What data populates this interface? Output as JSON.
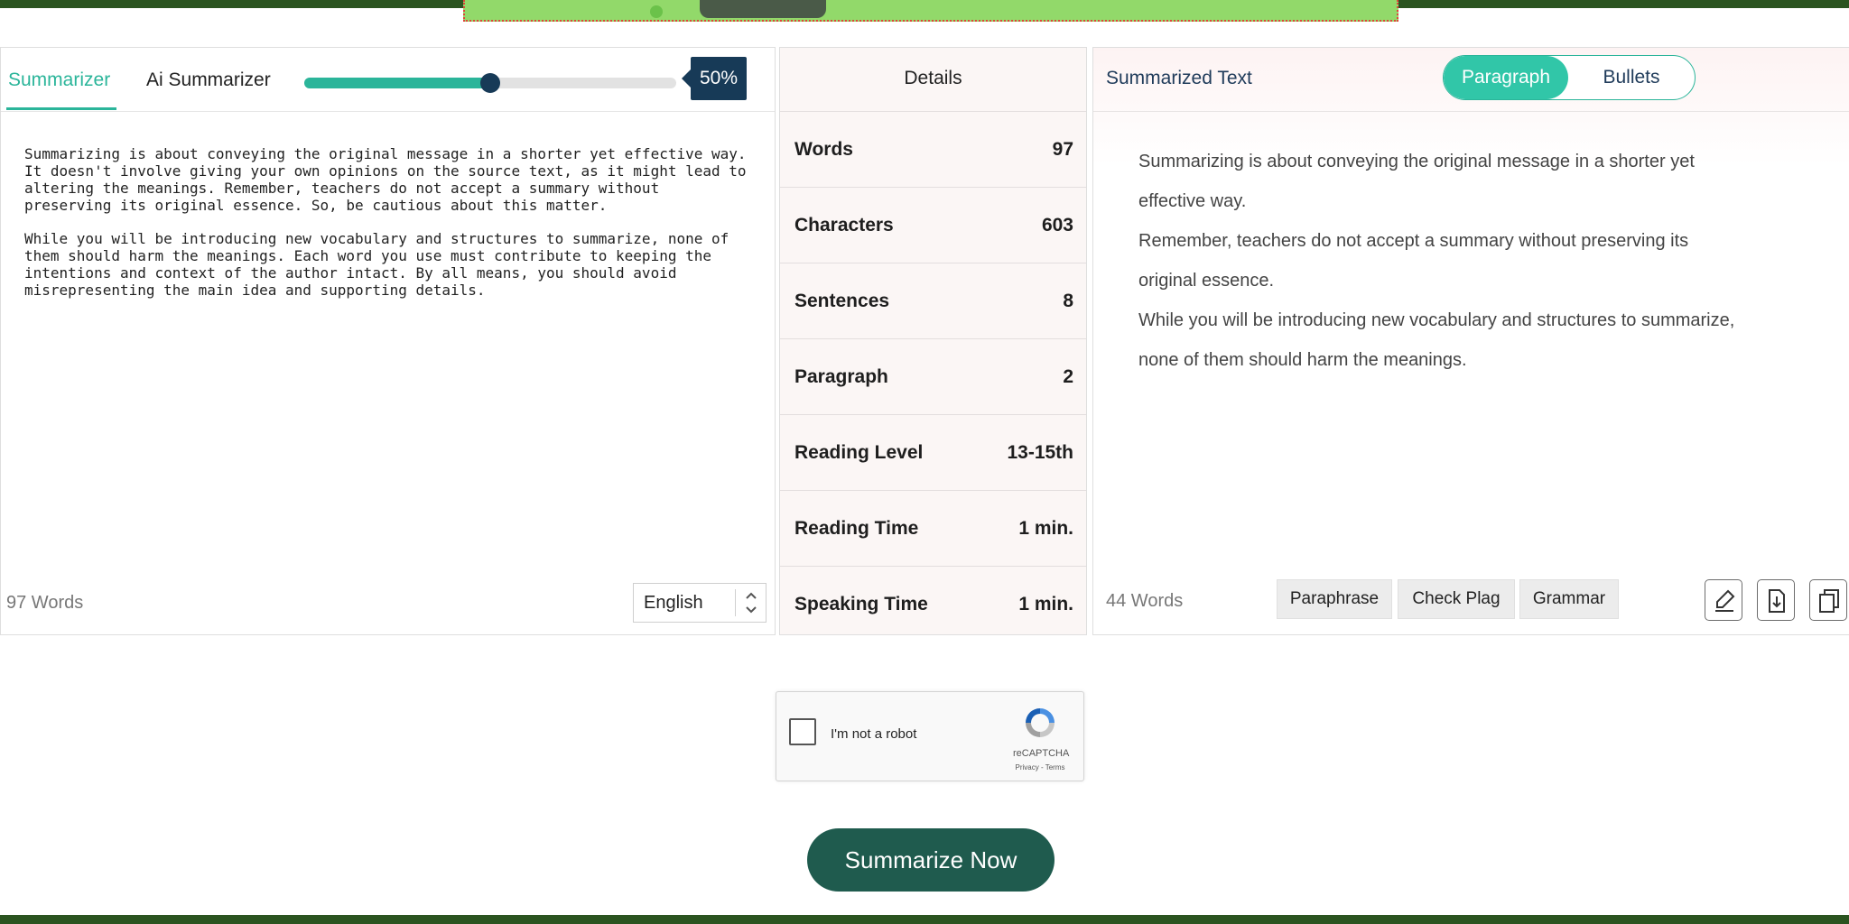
{
  "left": {
    "tab_active": "Summarizer",
    "tab_other": "Ai Summarizer",
    "slider_value_label": "50%",
    "slider_fraction": 0.5,
    "source_paragraphs": [
      "Summarizing is about conveying the original message in a shorter yet effective way. It doesn't involve giving your own opinions on the source text, as it might lead to altering the meanings. Remember, teachers do not accept a summary without preserving its original essence. So, be cautious about this matter.",
      "While you will be introducing new vocabulary and structures to summarize, none of them should harm the meanings. Each word you use must contribute to keeping the intentions and context of the author intact. By all means, you should avoid misrepresenting the main idea and supporting details."
    ],
    "word_count": "97 Words",
    "language": "English"
  },
  "details": {
    "title": "Details",
    "rows": [
      {
        "label": "Words",
        "value": "97"
      },
      {
        "label": "Characters",
        "value": "603"
      },
      {
        "label": "Sentences",
        "value": "8"
      },
      {
        "label": "Paragraph",
        "value": "2"
      },
      {
        "label": "Reading Level",
        "value": "13-15th"
      },
      {
        "label": "Reading Time",
        "value": "1 min."
      },
      {
        "label": "Speaking Time",
        "value": "1 min."
      }
    ]
  },
  "right": {
    "title": "Summarized Text",
    "toggle_active": "Paragraph",
    "toggle_other": "Bullets",
    "summary_lines": [
      "Summarizing is about conveying the original message in a shorter yet",
      "effective way.",
      "Remember, teachers do not accept a summary without preserving its",
      "original essence.",
      "While you will be introducing new vocabulary and structures to summarize,",
      "none of them should harm the meanings."
    ],
    "word_count": "44 Words",
    "actions": [
      "Paraphrase",
      "Check Plag",
      "Grammar"
    ],
    "icons": [
      "highlighter-icon",
      "download-icon",
      "copy-icon"
    ]
  },
  "captcha": {
    "label": "I'm not a robot",
    "brand": "reCAPTCHA",
    "links": "Privacy - Terms"
  },
  "submit_label": "Summarize Now",
  "colors": {
    "accent": "#2bb59a",
    "navy": "#173a57",
    "button_dark_green": "#1f5b4e",
    "frame_green": "#2b5420"
  }
}
